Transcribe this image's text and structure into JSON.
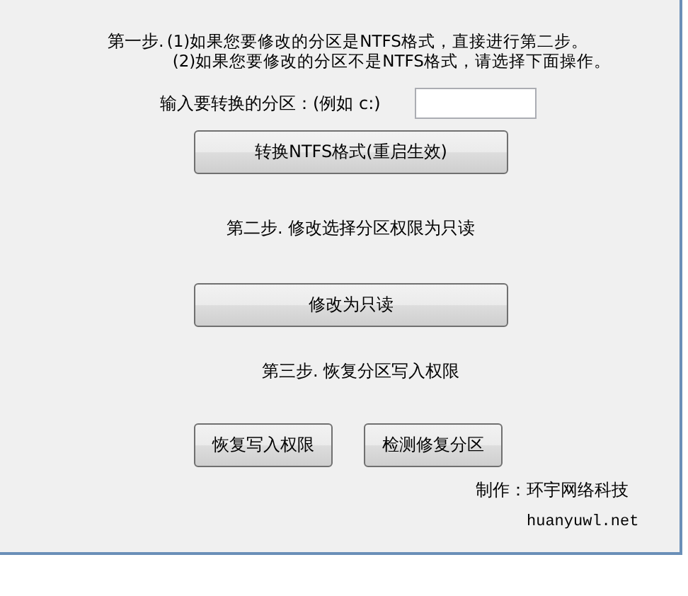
{
  "step1": {
    "label": "第一步.",
    "lines": [
      "(1)如果您要修改的分区是NTFS格式，直接进行第二步。",
      "(2)如果您要修改的分区不是NTFS格式，请选择下面操作。"
    ]
  },
  "partition_input": {
    "label": "输入要转换的分区：(例如 c:)"
  },
  "convert_button": "转换NTFS格式(重启生效)",
  "step2": "第二步. 修改选择分区权限为只读",
  "readonly_button": "修改为只读",
  "step3": "第三步. 恢复分区写入权限",
  "bottom_buttons": [
    "恢复写入权限",
    "检测修复分区"
  ],
  "credit": "制作：环宇网络科技",
  "website": "huanyuwl.net"
}
